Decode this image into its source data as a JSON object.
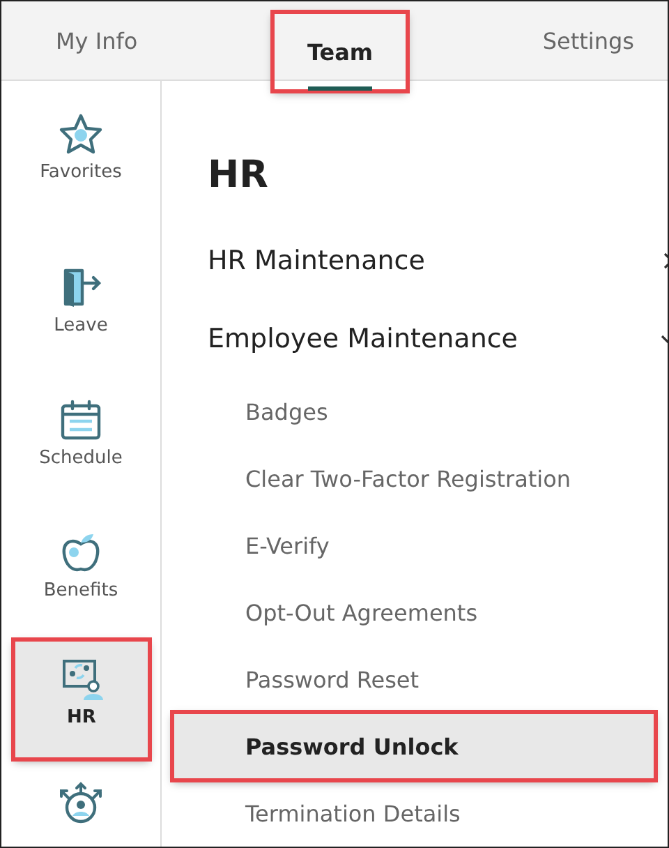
{
  "tabs": [
    {
      "label": "My Info",
      "selected": false,
      "highlighted": false
    },
    {
      "label": "Team",
      "selected": true,
      "highlighted": true
    },
    {
      "label": "Settings",
      "selected": false,
      "highlighted": false
    }
  ],
  "sidebar": {
    "items": [
      {
        "label": "Favorites",
        "selected": false,
        "highlighted": false
      },
      {
        "label": "Leave",
        "selected": false,
        "highlighted": false
      },
      {
        "label": "Schedule",
        "selected": false,
        "highlighted": false
      },
      {
        "label": "Benefits",
        "selected": false,
        "highlighted": false
      },
      {
        "label": "HR",
        "selected": true,
        "highlighted": true
      },
      {
        "selected": false,
        "highlighted": false
      }
    ]
  },
  "menu": {
    "title": "HR",
    "groups": [
      {
        "label": "HR Maintenance",
        "expanded": false
      },
      {
        "label": "Employee Maintenance",
        "expanded": true,
        "children": [
          {
            "label": "Badges",
            "selected": false,
            "highlighted": false
          },
          {
            "label": "Clear Two-Factor Registration",
            "selected": false,
            "highlighted": false
          },
          {
            "label": "E-Verify",
            "selected": false,
            "highlighted": false
          },
          {
            "label": "Opt-Out Agreements",
            "selected": false,
            "highlighted": false
          },
          {
            "label": "Password Reset",
            "selected": false,
            "highlighted": false
          },
          {
            "label": "Password Unlock",
            "selected": true,
            "highlighted": true
          },
          {
            "label": "Termination Details",
            "selected": false,
            "highlighted": false
          }
        ]
      }
    ]
  }
}
